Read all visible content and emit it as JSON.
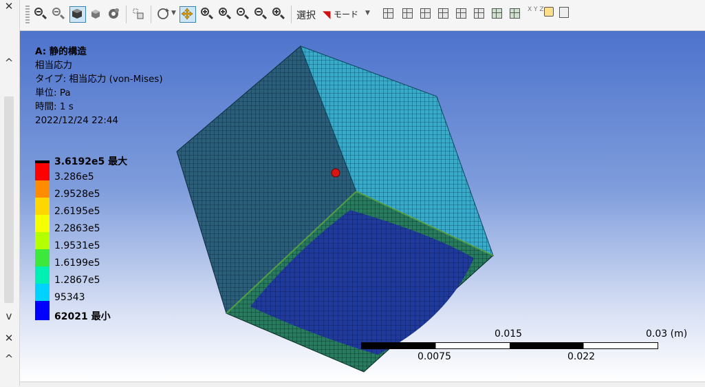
{
  "left_panel": {
    "close_top": "✕",
    "close_bottom": "✕",
    "arrow_up": "^",
    "arrow_down": "v",
    "arrow_up2": "^"
  },
  "toolbar": {
    "select_label": "選択",
    "mode_label": "モード",
    "axis_label": "X Y Z"
  },
  "info": {
    "analysis": "A: 静的構造",
    "result": "相当応力",
    "type": "タイプ: 相当応力 (von-Mises)",
    "unit": "単位: Pa",
    "time": "時間: 1 s",
    "timestamp": "2022/12/24 22:44"
  },
  "legend": {
    "levels": [
      {
        "label": "3.6192e5 最大",
        "color": "#ff0000",
        "bold": true
      },
      {
        "label": "3.286e5",
        "color": "#ff6a00"
      },
      {
        "label": "2.9528e5",
        "color": "#ffc800"
      },
      {
        "label": "2.6195e5",
        "color": "#f5ff00"
      },
      {
        "label": "2.2863e5",
        "color": "#b4ff00"
      },
      {
        "label": "1.9531e5",
        "color": "#3cff3c"
      },
      {
        "label": "1.6199e5",
        "color": "#00ffb4"
      },
      {
        "label": "1.2867e5",
        "color": "#00dcff"
      },
      {
        "label": "95343",
        "color": "#0096ff"
      },
      {
        "label": "62021 最小",
        "color": "#0000ff",
        "bold": true
      }
    ],
    "top_color": "#000000"
  },
  "scale_bar": {
    "top_labels": [
      "0.015",
      "0.03 (m)"
    ],
    "bottom_labels": [
      "0.0075",
      "0.022"
    ]
  },
  "colors": {
    "background_top": "#4d73cc",
    "mesh_blue": "#1e3c8c",
    "face_dark": "#2a5a78",
    "face_cyan": "#39b4cc"
  }
}
